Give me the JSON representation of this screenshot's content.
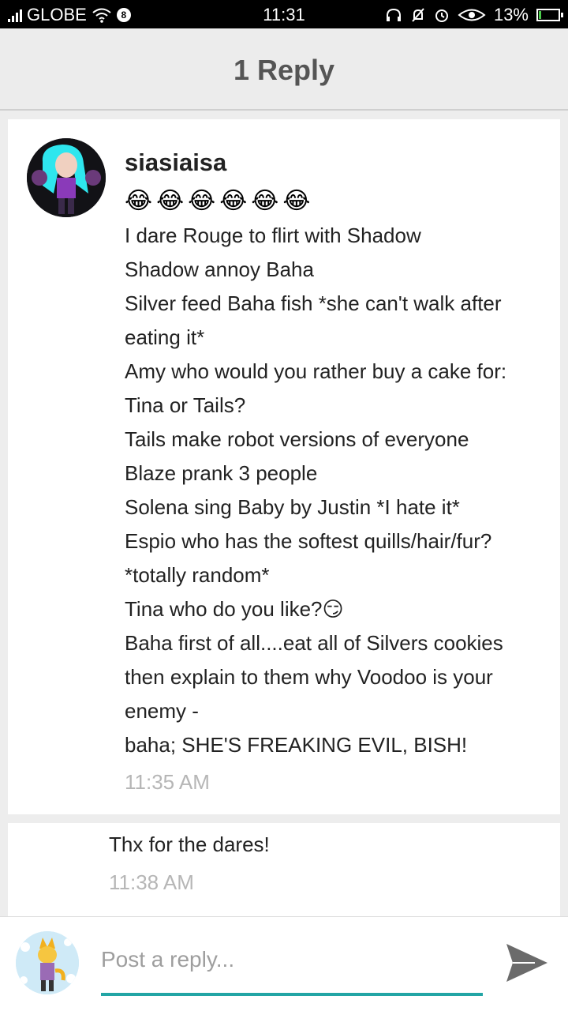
{
  "status_bar": {
    "carrier": "GLOBE",
    "time": "11:31",
    "battery_percent": "13%",
    "battery_level": 0.13,
    "icons": [
      "signal-icon",
      "wifi-icon",
      "vpn-icon",
      "headphones-icon",
      "mute-icon",
      "alarm-icon",
      "eye-icon",
      "battery-icon"
    ]
  },
  "header": {
    "title": "1 Reply"
  },
  "comment": {
    "username": "siasiaisa",
    "emojis": [
      "😂",
      "😂",
      "😂",
      "😂",
      "😂",
      "😂"
    ],
    "lines": [
      "I dare Rouge to flirt with Shadow",
      "Shadow annoy Baha",
      "Silver feed Baha fish *she can't walk after",
      "eating it*",
      "Amy who would you rather buy a cake for:",
      "Tina or Tails?",
      "Tails make robot versions of everyone",
      "Blaze prank 3 people",
      "Solena sing Baby by Justin  *I hate it*",
      "Espio who has the softest quills/hair/fur?",
      "*totally random*",
      "Tina who do you like?😏",
      "Baha first of all....eat all of Silvers cookies",
      "then explain to them why Voodoo is your",
      "enemy -",
      "baha; SHE'S FREAKING EVIL, BISH!"
    ],
    "time": "11:35 AM"
  },
  "reply": {
    "text": "Thx for the dares!",
    "time": "11:38 AM"
  },
  "composer": {
    "placeholder": "Post a reply...",
    "value": "",
    "send_icon": "send-icon"
  },
  "colors": {
    "accent": "#22a5a5",
    "timestamp": "#b6b6b6",
    "header_bg": "#ececec"
  }
}
